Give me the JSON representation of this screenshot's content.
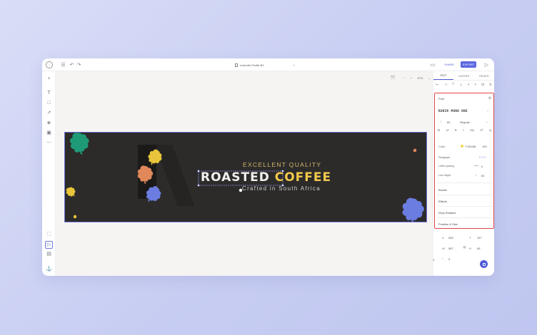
{
  "topbar": {
    "doc_title": "LinkedIn Profile B2",
    "share_label": "SHARE",
    "export_label": "EXPORT"
  },
  "canvas": {
    "zoom": "37%"
  },
  "banner": {
    "subtitle": "EXCELLENT QUALITY",
    "headline_part1": "ROASTED",
    "headline_part2": "COFFEE",
    "tagline": "Crafted in South Africa",
    "colors": {
      "background": "#2d2b2a",
      "headline_yellow": "#f2c94c",
      "leaf_green": "#1f9a78",
      "leaf_blue": "#6b7de0",
      "leaf_orange": "#e0885a",
      "leaf_yellow": "#e8c53a"
    }
  },
  "panel": {
    "tabs": [
      "EDIT",
      "LAYERS",
      "PAGES"
    ],
    "font_section": "Font",
    "font_name": "RUBIK MONO ONE",
    "font_size": "60",
    "font_weight": "Regular",
    "color_label": "Color",
    "color_hex": "F2D458",
    "color_opacity": "100",
    "paragraph_label": "Paragraph",
    "letter_spacing_label": "Letter spacing",
    "letter_spacing_value": "0",
    "line_height_label": "Line height",
    "line_height_value": "60",
    "sections": [
      "Border",
      "Effects",
      "Drop Shadow",
      "Position & Size"
    ],
    "pos_x_label": "X",
    "pos_x": "546",
    "pos_y_label": "Y",
    "pos_y": "167",
    "size_w_label": "W",
    "size_w": "587",
    "size_h_label": "H",
    "size_h": "65",
    "rotation": "0"
  }
}
